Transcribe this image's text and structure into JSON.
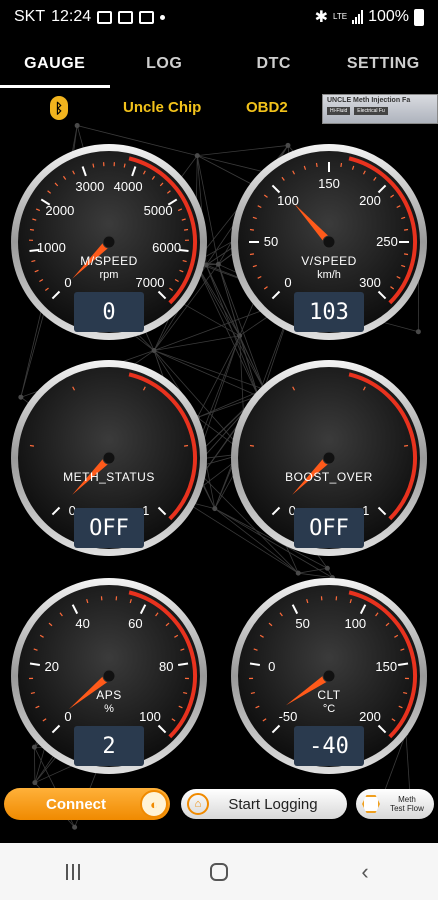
{
  "status_bar": {
    "carrier": "SKT",
    "time": "12:24",
    "network": "LTE",
    "battery": "100%"
  },
  "tabs": [
    {
      "label": "GAUGE",
      "active": true
    },
    {
      "label": "LOG",
      "active": false
    },
    {
      "label": "DTC",
      "active": false
    },
    {
      "label": "SETTING",
      "active": false
    }
  ],
  "info_bar": {
    "bluetooth_icon": "bluetooth-icon",
    "brand": "Uncle Chip",
    "protocol": "OBD2",
    "banner": {
      "title": "UNCLE Meth Injection Fa",
      "tags": [
        "Hi-Fluid",
        "Electrical Fu"
      ]
    }
  },
  "gauges": [
    {
      "id": "rpm",
      "name": "M/SPEED",
      "unit": "rpm",
      "min": 0,
      "max": 7000,
      "ticks": [
        0,
        1000,
        2000,
        3000,
        4000,
        5000,
        6000,
        7000
      ],
      "value": 0,
      "readout": "0"
    },
    {
      "id": "speed",
      "name": "V/SPEED",
      "unit": "km/h",
      "min": 0,
      "max": 300,
      "ticks": [
        0,
        50,
        100,
        150,
        200,
        250,
        300
      ],
      "value": 103,
      "readout": "103"
    },
    {
      "id": "meth",
      "name": "METH_STATUS",
      "unit": "",
      "min": 0,
      "max": 1,
      "ticks": [
        0,
        1
      ],
      "value": 0,
      "readout": "OFF"
    },
    {
      "id": "boost",
      "name": "BOOST_OVER",
      "unit": "",
      "min": 0,
      "max": 1,
      "ticks": [
        0,
        1
      ],
      "value": 0,
      "readout": "OFF"
    },
    {
      "id": "aps",
      "name": "APS",
      "unit": "%",
      "min": 0,
      "max": 100,
      "ticks": [
        0,
        20,
        40,
        60,
        80,
        100
      ],
      "value": 2,
      "readout": "2"
    },
    {
      "id": "clt",
      "name": "CLT",
      "unit": "°C",
      "min": -50,
      "max": 200,
      "ticks": [
        -50,
        0,
        50,
        100,
        150,
        200
      ],
      "value": -40,
      "readout": "-40"
    }
  ],
  "actions": {
    "connect": "Connect",
    "start_logging": "Start Logging",
    "meth_test_flow": [
      "Meth",
      "Test Flow"
    ]
  },
  "colors": {
    "accent": "#f2c21b",
    "needle": "#ff5a1a",
    "redline": "#e8321e",
    "readout_bg": "#2a3a4e"
  }
}
